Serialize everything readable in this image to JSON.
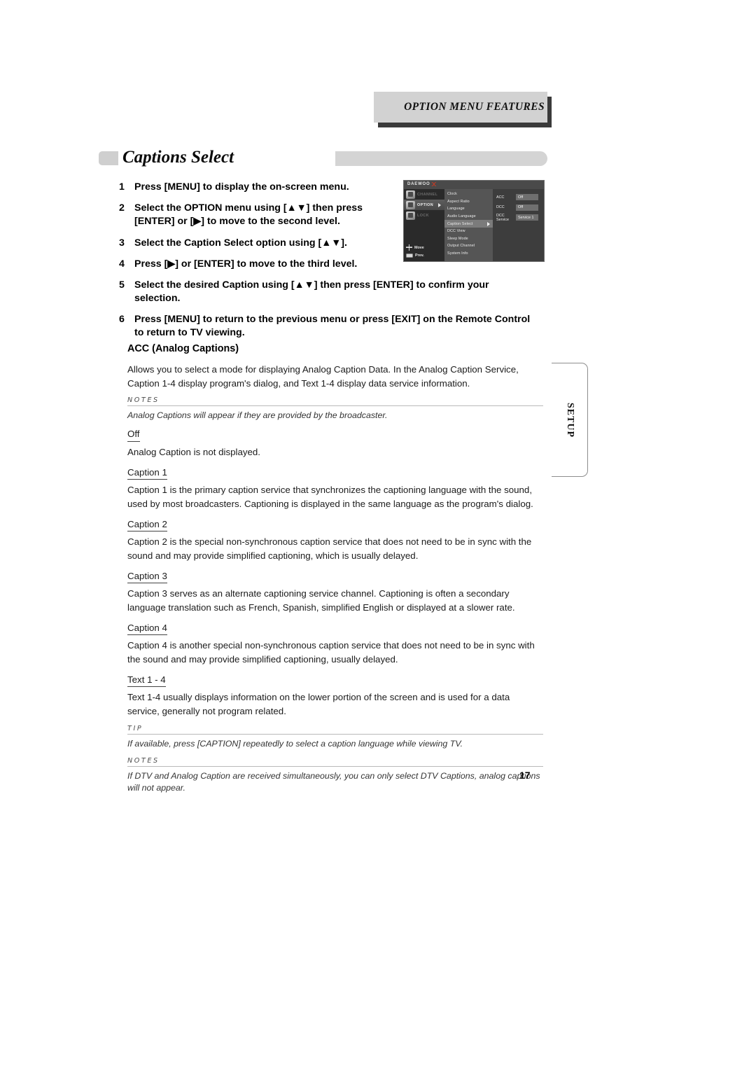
{
  "header": {
    "banner_title": "Option Menu Features"
  },
  "section": {
    "title": "Captions Select"
  },
  "steps": [
    {
      "num": "1",
      "text": "Press [MENU] to display the on-screen menu."
    },
    {
      "num": "2",
      "text": "Select the OPTION menu using [▲▼] then press [ENTER] or [▶] to move to the second level."
    },
    {
      "num": "3",
      "text": "Select the Caption Select option using [▲▼]."
    },
    {
      "num": "4",
      "text": "Press [▶] or [ENTER] to move to the third level."
    },
    {
      "num": "5",
      "text": "Select the desired Caption using [▲▼] then press [ENTER] to confirm your selection."
    },
    {
      "num": "6",
      "text": "Press [MENU] to return to the previous menu or press [EXIT] on the Remote Control to return to TV viewing."
    }
  ],
  "osd": {
    "brand": "DAEWOO",
    "left_items": [
      {
        "label": "CHANNEL",
        "active": false
      },
      {
        "label": "OPTION",
        "active": true
      },
      {
        "label": "LOCK",
        "active": false
      }
    ],
    "menu_items": [
      {
        "label": "Clock",
        "selected": false
      },
      {
        "label": "Aspect Ratio",
        "selected": false
      },
      {
        "label": "Language",
        "selected": false
      },
      {
        "label": "Audio Language",
        "selected": false
      },
      {
        "label": "Caption Select",
        "selected": true
      },
      {
        "label": "DCC View",
        "selected": false
      },
      {
        "label": "Sleep Mode",
        "selected": false
      },
      {
        "label": "Output Channel",
        "selected": false
      },
      {
        "label": "System Info",
        "selected": false
      }
    ],
    "settings": [
      {
        "key": "ACC",
        "value": "Off"
      },
      {
        "key": "DCC",
        "value": "Off"
      },
      {
        "key": "DCC Service",
        "value": "Service 1"
      }
    ],
    "nav": [
      {
        "label": "Move"
      },
      {
        "label": "Prev."
      }
    ]
  },
  "content": {
    "sub_head": "ACC (Analog Captions)",
    "intro": "Allows you to select a mode for displaying Analog Caption Data. In the Analog Caption Service, Caption 1-4 display program's dialog, and Text 1-4 display data service information.",
    "note_1": {
      "label": "NOTES",
      "body": "Analog Captions will appear if they are provided by the broadcaster."
    },
    "terms": [
      {
        "term": "Off",
        "desc": "Analog Caption is not displayed."
      },
      {
        "term": "Caption 1",
        "desc": "Caption 1 is the primary caption service that synchronizes the captioning language with the sound, used by most broadcasters. Captioning is displayed in the same language as the program's dialog."
      },
      {
        "term": "Caption 2",
        "desc": "Caption 2 is the special non-synchronous caption service that does not need to be in sync with the sound and may provide simplified captioning, which is usually delayed."
      },
      {
        "term": "Caption 3",
        "desc": "Caption 3 serves as an alternate captioning service channel. Captioning is often a secondary language translation such as French, Spanish, simplified English or displayed at a slower rate."
      },
      {
        "term": "Caption 4",
        "desc": "Caption 4 is another special non-synchronous caption service that does not need to be in sync with the sound and may provide simplified captioning, usually delayed."
      },
      {
        "term": "Text 1 - 4",
        "desc": "Text 1-4 usually displays information on the lower portion of the screen and is used for a data service, generally not program related."
      }
    ],
    "tip": {
      "label": "TIP",
      "body": "If available, press [CAPTION] repeatedly to select a caption language while viewing TV."
    },
    "note_2": {
      "label": "NOTES",
      "body": "If DTV and Analog Caption are received simultaneously, you can only select DTV Captions, analog captions will not appear."
    }
  },
  "side_tab": {
    "label": "SETUP"
  },
  "page": {
    "number": "17"
  }
}
